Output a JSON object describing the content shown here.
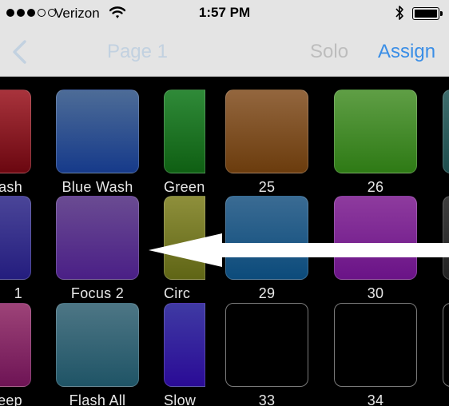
{
  "status_bar": {
    "carrier": "Verizon",
    "time": "1:57 PM",
    "signal_dots_filled": 3,
    "signal_dots_total": 5
  },
  "nav": {
    "back_icon": "chevron-left-icon",
    "title": "Page 1",
    "solo_label": "Solo",
    "assign_label": "Assign"
  },
  "colors": {
    "assign_blue": "#3a8ee6",
    "nav_background": "#e4e4e4",
    "grid_background": "#000000"
  },
  "rows": [
    {
      "cells": [
        {
          "label": "ash",
          "colors": [
            "#a8333c",
            "#6b0710"
          ]
        },
        {
          "label": "Blue Wash",
          "colors": [
            "#4d6c97",
            "#163a8a"
          ]
        },
        {
          "label": "Green",
          "colors": [
            "#2f8a38",
            "#0f5f13"
          ]
        },
        {
          "label": "25",
          "colors": [
            "#93663e",
            "#6b3c0d"
          ]
        },
        {
          "label": "26",
          "colors": [
            "#5f9e45",
            "#2e7a15"
          ]
        },
        {
          "label": "",
          "colors": [
            "#3d6b6b",
            "#1e4d4d"
          ]
        }
      ]
    },
    {
      "cells": [
        {
          "label": "1",
          "colors": [
            "#4a4598",
            "#241d7e"
          ]
        },
        {
          "label": "Focus 2",
          "colors": [
            "#6a4b92",
            "#4a1f86"
          ]
        },
        {
          "label": "Circ",
          "colors": [
            "#8e8f3b",
            "#5f6515"
          ]
        },
        {
          "label": "29",
          "colors": [
            "#3a6b93",
            "#0c4b7b"
          ]
        },
        {
          "label": "30",
          "colors": [
            "#8e3b9e",
            "#6a1387"
          ]
        },
        {
          "label": "",
          "colors": [
            "#3d3d3d",
            "#222"
          ]
        }
      ]
    },
    {
      "cells": [
        {
          "label": "eep",
          "colors": [
            "#9d4378",
            "#6e1455"
          ]
        },
        {
          "label": "Flash All",
          "colors": [
            "#4d7685",
            "#1f5466"
          ]
        },
        {
          "label": "Slow",
          "colors": [
            "#3f3aa3",
            "#2a0b96"
          ]
        },
        {
          "label": "33",
          "colors": null
        },
        {
          "label": "34",
          "colors": null
        },
        {
          "label": "",
          "colors": null
        }
      ]
    }
  ]
}
